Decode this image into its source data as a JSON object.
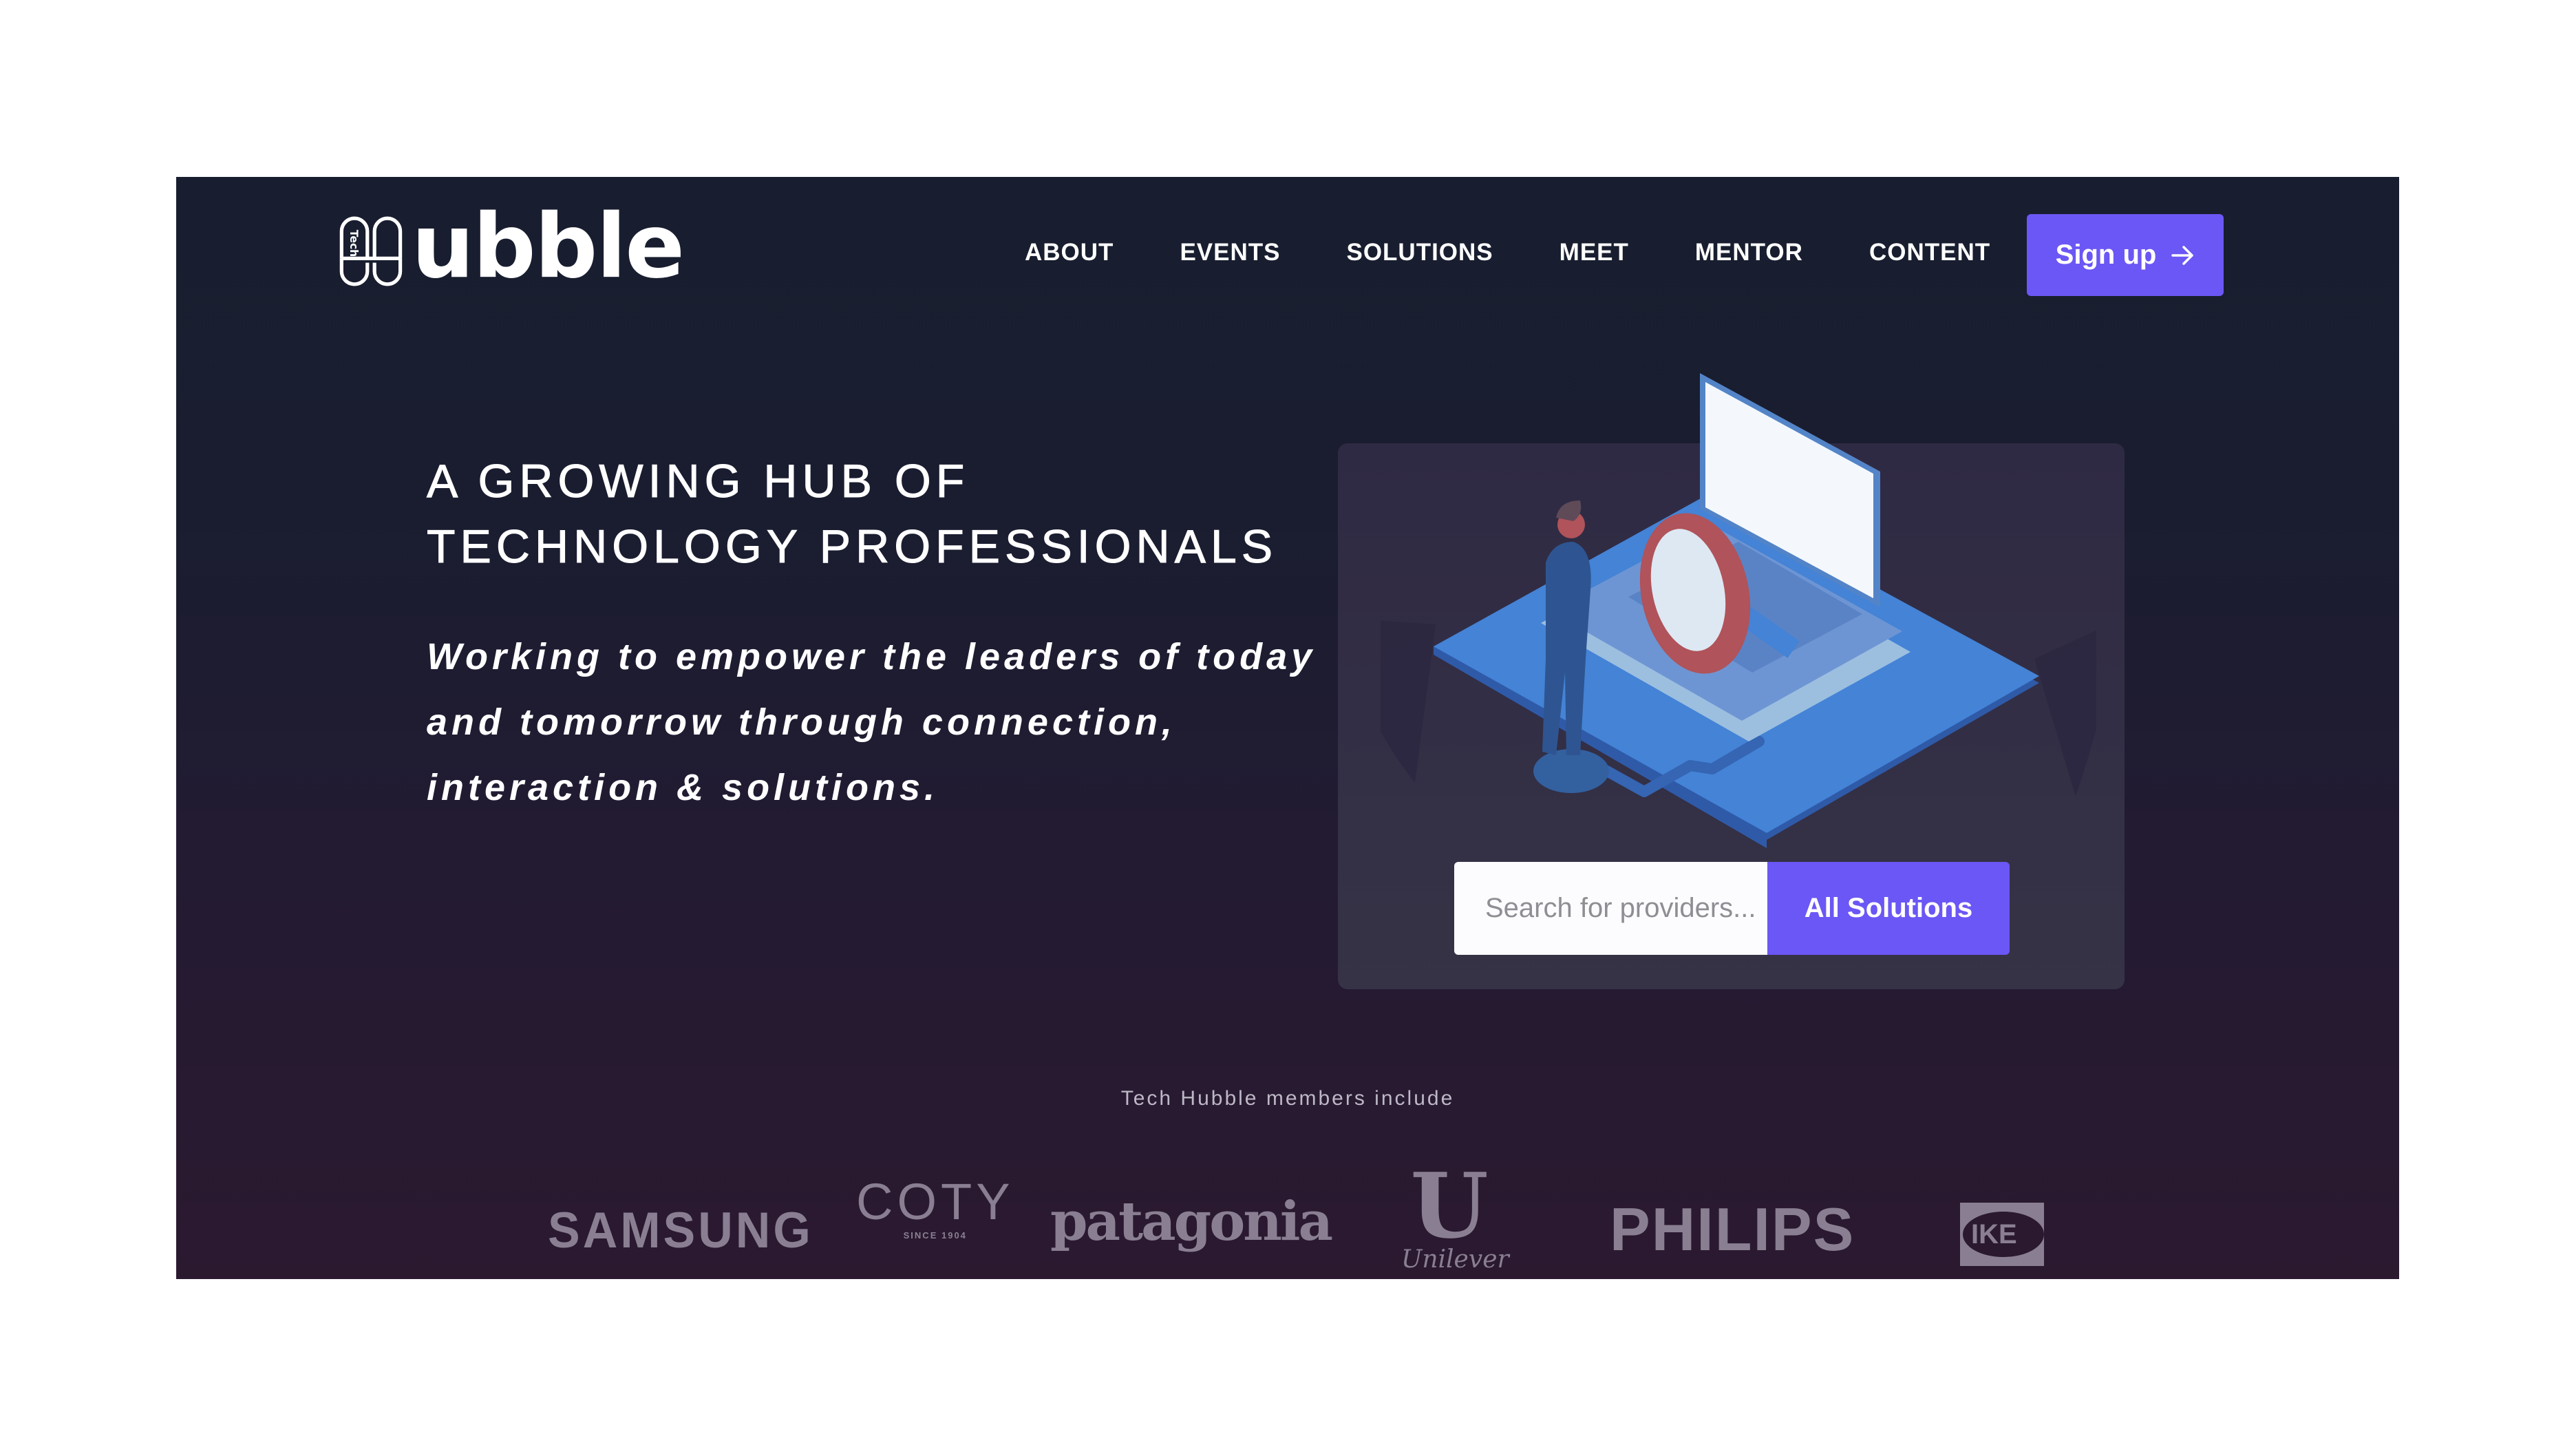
{
  "brand": {
    "logo_prefix": "Tech",
    "logo_word": "ubble"
  },
  "nav": {
    "items": [
      {
        "label": "ABOUT"
      },
      {
        "label": "EVENTS"
      },
      {
        "label": "SOLUTIONS"
      },
      {
        "label": "MEET"
      },
      {
        "label": "MENTOR"
      },
      {
        "label": "CONTENT"
      }
    ],
    "signup_label": "Sign up",
    "signup_icon": "arrow-right-icon"
  },
  "hero": {
    "headline_line1": "A GROWING HUB OF",
    "headline_line2": "TECHNOLOGY PROFESSIONALS",
    "subhead_line1": "Working to empower the leaders of today",
    "subhead_line2": "and tomorrow through connection,",
    "subhead_line3": "interaction & solutions.",
    "illustration": "person-with-magnifying-glass-and-laptop",
    "search": {
      "placeholder": "Search for providers...",
      "value": "",
      "button_label": "All Solutions"
    }
  },
  "members": {
    "label": "Tech Hubble members include",
    "logos": [
      {
        "name": "SAMSUNG"
      },
      {
        "name": "COTY",
        "tagline": "SINCE 1904"
      },
      {
        "name": "patagonia"
      },
      {
        "name": "Unilever",
        "mark": "U"
      },
      {
        "name": "PHILIPS"
      },
      {
        "name": "IKEA",
        "visible_text": "IKE"
      }
    ]
  },
  "colors": {
    "accent": "#6b57f5",
    "bg_top": "#181e2f",
    "bg_bottom": "#2b1930",
    "card": "#332f45",
    "logo_gray": "#8a7f92"
  }
}
